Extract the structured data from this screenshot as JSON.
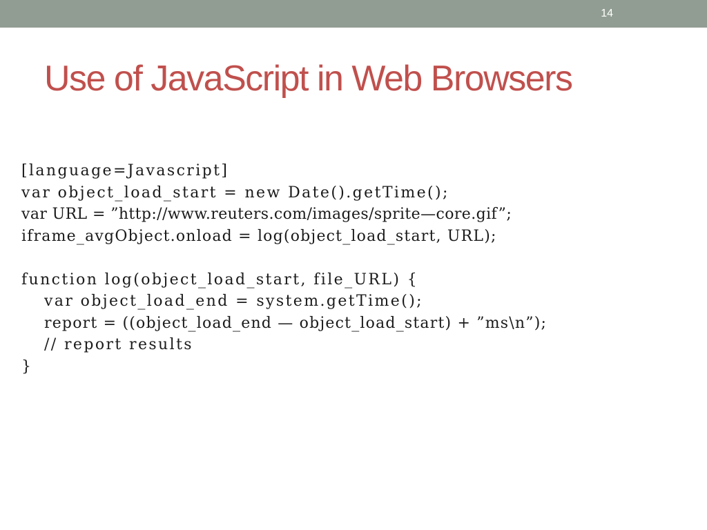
{
  "slide": {
    "number": "14",
    "title": "Use of JavaScript in Web Browsers"
  },
  "code": {
    "lines": [
      "[language=Javascript]",
      "var object_load_start = new Date().getTime();",
      "var URL = ”http://www.reuters.com/images/sprite—core.gif”;",
      "iframe_avgObject.onload = log(object_load_start, URL);",
      "",
      "function log(object_load_start, file_URL) {",
      "var object_load_end = system.getTime();",
      "report = ((object_load_end — object_load_start) + ”ms\\n”);",
      "// report results",
      "}"
    ]
  }
}
